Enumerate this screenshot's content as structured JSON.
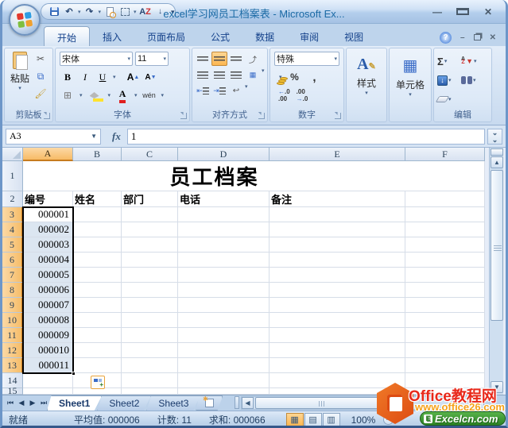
{
  "window": {
    "title": "excel学习网员工档案表 - Microsoft Ex..."
  },
  "ribbon_tabs": [
    {
      "label": "开始",
      "active": true
    },
    {
      "label": "插入",
      "active": false
    },
    {
      "label": "页面布局",
      "active": false
    },
    {
      "label": "公式",
      "active": false
    },
    {
      "label": "数据",
      "active": false
    },
    {
      "label": "审阅",
      "active": false
    },
    {
      "label": "视图",
      "active": false
    }
  ],
  "ribbon": {
    "clipboard": {
      "label": "剪贴板",
      "paste": "粘贴"
    },
    "font": {
      "label": "字体",
      "name": "宋体",
      "size": "11",
      "bold": "B",
      "italic": "I",
      "underline": "U",
      "grow": "A",
      "shrink": "A",
      "color": "A",
      "phonetic": "wén"
    },
    "alignment": {
      "label": "对齐方式"
    },
    "number": {
      "label": "数字",
      "format": "特殊",
      "percent": "%",
      "comma": ",",
      "inc_decimal": ".0",
      "dec_decimal": ".00"
    },
    "styles": {
      "label": "样式",
      "icon_letter": "A"
    },
    "cells": {
      "label": "单元格"
    },
    "editing": {
      "label": "编辑",
      "sum": "Σ"
    }
  },
  "formula_bar": {
    "name_box": "A3",
    "fx": "fx",
    "value": "1"
  },
  "grid": {
    "columns": [
      "A",
      "B",
      "C",
      "D",
      "E",
      "F"
    ],
    "selected_column": "A",
    "row_numbers": [
      "1",
      "2",
      "3",
      "4",
      "5",
      "6",
      "7",
      "8",
      "9",
      "10",
      "11",
      "12",
      "13",
      "14",
      "15"
    ],
    "selected_rows_from": 3,
    "selected_rows_to": 13,
    "title": "员工档案",
    "headers": [
      "编号",
      "姓名",
      "部门",
      "电话",
      "备注"
    ],
    "ids": [
      "000001",
      "000002",
      "000003",
      "000004",
      "000005",
      "000006",
      "000007",
      "000008",
      "000009",
      "000010",
      "000011"
    ]
  },
  "sheet_tabs": [
    {
      "label": "Sheet1",
      "active": true
    },
    {
      "label": "Sheet2",
      "active": false
    },
    {
      "label": "Sheet3",
      "active": false
    }
  ],
  "status": {
    "mode": "就绪",
    "average_label": "平均值:",
    "average_value": "000006",
    "count_label": "计数:",
    "count_value": "11",
    "sum_label": "求和:",
    "sum_value": "000066",
    "zoom": "100%"
  },
  "watermark": {
    "title": "Office教程网",
    "url": "www.office26.com",
    "badge": "Excelcn.com"
  },
  "colors": {
    "selection_fill": "#dce6f1",
    "selected_header": "#f8cd8c",
    "title_bar": "#bfd6ee",
    "active_view_btn": "#fcb651"
  }
}
